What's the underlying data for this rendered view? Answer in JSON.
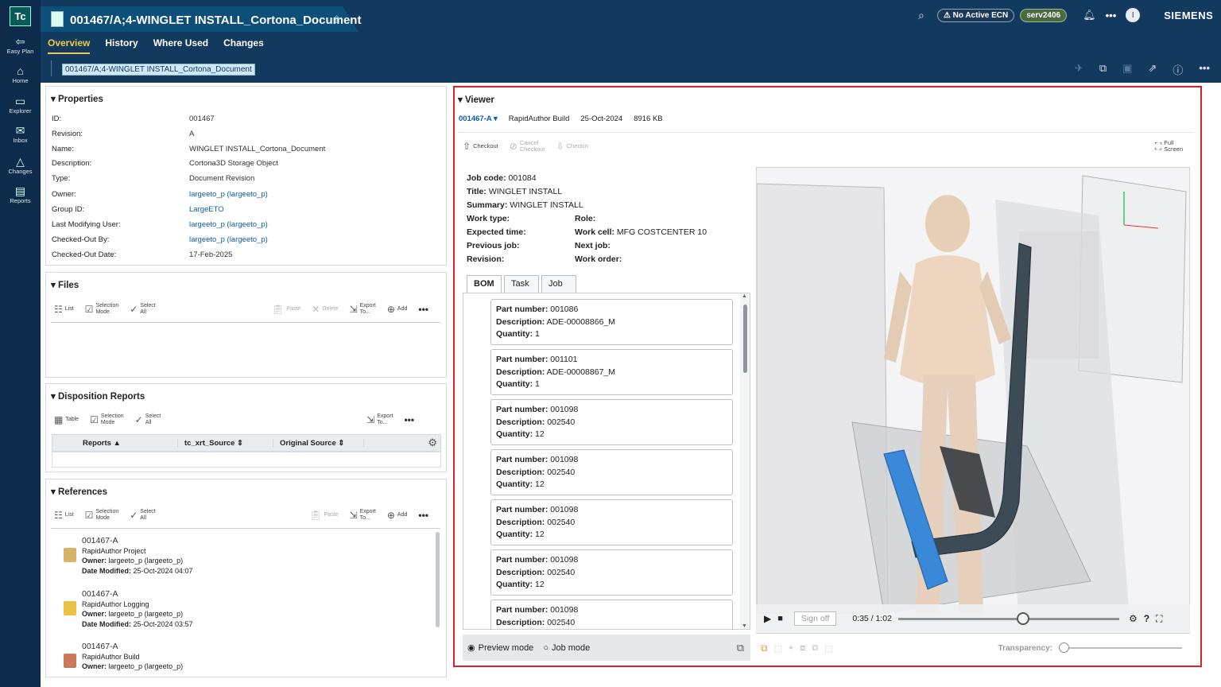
{
  "app": {
    "logo": "Tc",
    "title": "001467/A;4-WINGLET INSTALL_Cortona_Document",
    "brand": "SIEMENS"
  },
  "rail": [
    {
      "label": "Easy Plan",
      "icon": "easy-plan-icon",
      "glyph": "⇦"
    },
    {
      "label": "Home",
      "icon": "home-icon",
      "glyph": "⌂"
    },
    {
      "label": "Explorer",
      "icon": "folder-icon",
      "glyph": "▭"
    },
    {
      "label": "Inbox",
      "icon": "inbox-icon",
      "glyph": "✉"
    },
    {
      "label": "Changes",
      "icon": "changes-icon",
      "glyph": "△"
    },
    {
      "label": "Reports",
      "icon": "reports-icon",
      "glyph": "▤"
    }
  ],
  "header": {
    "ecn": "No Active ECN",
    "server": "serv2406",
    "avatar": "I"
  },
  "nav_tabs": [
    "Overview",
    "History",
    "Where Used",
    "Changes"
  ],
  "breadcrumb": "001467/A;4-WINGLET INSTALL_Cortona_Document",
  "properties": {
    "title": "Properties",
    "rows": [
      {
        "k": "ID:",
        "v": "001467",
        "link": false
      },
      {
        "k": "Revision:",
        "v": "A",
        "link": false
      },
      {
        "k": "Name:",
        "v": "WINGLET INSTALL_Cortona_Document",
        "link": false
      },
      {
        "k": "Description:",
        "v": "Cortona3D Storage Object",
        "link": false
      },
      {
        "k": "Type:",
        "v": "Document Revision",
        "link": false
      },
      {
        "k": "Owner:",
        "v": "largeeto_p (largeeto_p)",
        "link": true
      },
      {
        "k": "Group ID:",
        "v": "LargeETO",
        "link": true
      },
      {
        "k": "Last Modifying User:",
        "v": "largeeto_p (largeeto_p)",
        "link": true
      },
      {
        "k": "Checked-Out By:",
        "v": "largeeto_p (largeeto_p)",
        "link": true
      },
      {
        "k": "Checked-Out Date:",
        "v": "17-Feb-2025",
        "link": false
      }
    ]
  },
  "files": {
    "title": "Files",
    "list": "List",
    "selmode1": "Selection",
    "selmode2": "Mode",
    "selall1": "Select",
    "selall2": "All",
    "paste": "Paste",
    "delete": "Delete",
    "export1": "Export",
    "export2": "To...",
    "add": "Add"
  },
  "disposition": {
    "title": "Disposition Reports",
    "table": "Table",
    "columns": [
      "Reports",
      "tc_xrt_Source",
      "Original Source"
    ]
  },
  "references": {
    "title": "References",
    "items": [
      {
        "id": "001467-A",
        "type": "RapidAuthor Project",
        "owner": "largeeto_p (largeeto_p)",
        "date": "25-Oct-2024 04:07"
      },
      {
        "id": "001467-A",
        "type": "RapidAuthor Logging",
        "owner": "largeeto_p (largeeto_p)",
        "date": "25-Oct-2024 03:57"
      },
      {
        "id": "001467-A",
        "type": "RapidAuthor Build",
        "owner": "largeeto_p (largeeto_p)",
        "date": ""
      }
    ],
    "owner_label": "Owner:",
    "date_label": "Date Modified:"
  },
  "viewer": {
    "title": "Viewer",
    "rev": "001467-A",
    "build": "RapidAuthor Build",
    "date": "25-Oct-2024",
    "size": "8916 KB",
    "checkout": "Checkout",
    "cancel1": "Cancel",
    "cancel2": "Checkout",
    "checkin": "Checkin",
    "full1": "Full",
    "full2": "Screen",
    "job": {
      "code_l": "Job code:",
      "code": "001084",
      "title_l": "Title:",
      "title": "WINGLET INSTALL",
      "summary_l": "Summary:",
      "summary": "WINGLET INSTALL",
      "worktype_l": "Work type:",
      "role_l": "Role:",
      "exptime_l": "Expected time:",
      "workcell_l": "Work cell:",
      "workcell": "MFG COSTCENTER 10",
      "prevjob_l": "Previous job:",
      "nextjob_l": "Next job:",
      "revision_l": "Revision:",
      "workorder_l": "Work order:"
    },
    "tabs": [
      "BOM",
      "Task",
      "Job"
    ],
    "bom": [
      {
        "pn": "001086",
        "desc": "ADE-00008866_M",
        "qty": "1"
      },
      {
        "pn": "001101",
        "desc": "ADE-00008867_M",
        "qty": "1"
      },
      {
        "pn": "001098",
        "desc": "002540",
        "qty": "12"
      },
      {
        "pn": "001098",
        "desc": "002540",
        "qty": "12"
      },
      {
        "pn": "001098",
        "desc": "002540",
        "qty": "12"
      },
      {
        "pn": "001098",
        "desc": "002540",
        "qty": "12"
      },
      {
        "pn": "001098",
        "desc": "002540",
        "qty": ""
      }
    ],
    "bom_labels": {
      "pn": "Part number:",
      "desc": "Description:",
      "qty": "Quantity:"
    },
    "preview_mode": "Preview mode",
    "job_mode": "Job mode",
    "signoff": "Sign off",
    "time": "0:35 / 1:02",
    "progress": 0.565,
    "transparency_label": "Transparency:",
    "transparency": 0.0
  },
  "colors": {
    "accent": "#f4c84a",
    "highlight": "#d6232b",
    "link": "#0d5ea8",
    "nav": "#123a5e"
  }
}
